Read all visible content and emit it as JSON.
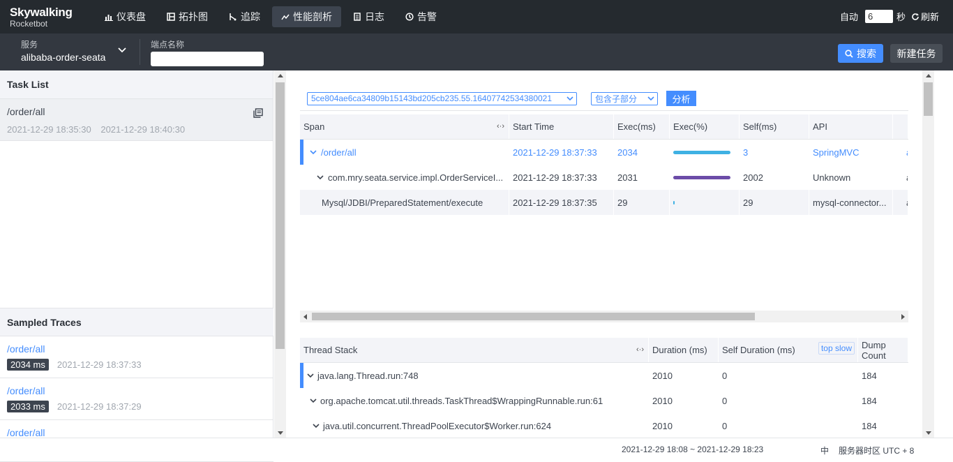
{
  "brand": {
    "name": "Skywalking",
    "sub": "Rocketbot"
  },
  "nav": [
    {
      "label": "仪表盘",
      "icon": "dashboard-icon",
      "active": false
    },
    {
      "label": "拓扑图",
      "icon": "topology-icon",
      "active": false
    },
    {
      "label": "追踪",
      "icon": "trace-icon",
      "active": false
    },
    {
      "label": "性能剖析",
      "icon": "profile-icon",
      "active": true
    },
    {
      "label": "日志",
      "icon": "log-icon",
      "active": false
    },
    {
      "label": "告警",
      "icon": "alarm-icon",
      "active": false
    }
  ],
  "auto_refresh": {
    "label": "自动",
    "interval": "6",
    "unit": "秒",
    "refresh_label": "刷新"
  },
  "filter": {
    "service_label": "服务",
    "service_value": "alibaba-order-seata",
    "endpoint_label": "端点名称",
    "endpoint_value": "",
    "search_label": "搜索",
    "new_task_label": "新建任务"
  },
  "task_list": {
    "title": "Task List",
    "items": [
      {
        "name": "/order/all",
        "start": "2021-12-29 18:35:30",
        "end": "2021-12-29 18:40:30"
      }
    ]
  },
  "sampled_traces": {
    "title": "Sampled Traces",
    "items": [
      {
        "name": "/order/all",
        "duration": "2034 ms",
        "time": "2021-12-29 18:37:33"
      },
      {
        "name": "/order/all",
        "duration": "2033 ms",
        "time": "2021-12-29 18:37:29"
      },
      {
        "name": "/order/all",
        "duration": "",
        "time": ""
      }
    ]
  },
  "analysis": {
    "segment_id": "5ce804ae6ca34809b15143bd205cb235.55.16407742534380021",
    "mode": "包含子部分",
    "analyze_label": "分析"
  },
  "span_table": {
    "headers": [
      "Span",
      "Start Time",
      "Exec(ms)",
      "Exec(%)",
      "Self(ms)",
      "API",
      ""
    ],
    "resize_glyph": "‹·›",
    "rows": [
      {
        "span": "/order/all",
        "start": "2021-12-29 18:37:33",
        "exec": "2034",
        "pct": 1.0,
        "self": "3",
        "api": "SpringMVC",
        "extra": "a",
        "bar_color": "#3fb1e3",
        "expand": true
      },
      {
        "span": "com.mry.seata.service.impl.OrderServiceI...",
        "start": "2021-12-29 18:37:33",
        "exec": "2031",
        "pct": 0.998,
        "self": "2002",
        "api": "Unknown",
        "extra": "a",
        "bar_color": "#6c4ca8",
        "expand": true
      },
      {
        "span": "Mysql/JDBI/PreparedStatement/execute",
        "start": "2021-12-29 18:37:35",
        "exec": "29",
        "pct": 0.014,
        "self": "29",
        "api": "mysql-connector...",
        "extra": "a",
        "bar_color": "#3fb1e3",
        "expand": false
      }
    ]
  },
  "thread_table": {
    "headers": [
      "Thread Stack",
      "Duration (ms)",
      "Self Duration (ms)",
      "Dump Count"
    ],
    "top_slow_label": "top slow",
    "rows": [
      {
        "stack": "java.lang.Thread.run:748",
        "duration": "2010",
        "self": "0",
        "count": "184"
      },
      {
        "stack": "org.apache.tomcat.util.threads.TaskThread$WrappingRunnable.run:61",
        "duration": "2010",
        "self": "0",
        "count": "184"
      },
      {
        "stack": "java.util.concurrent.ThreadPoolExecutor$Worker.run:624",
        "duration": "2010",
        "self": "0",
        "count": "184"
      }
    ]
  },
  "footer": {
    "range": "2021-12-29 18:08 ~ 2021-12-29 18:23",
    "lang": "中",
    "timezone": "服务器时区 UTC + 8"
  }
}
